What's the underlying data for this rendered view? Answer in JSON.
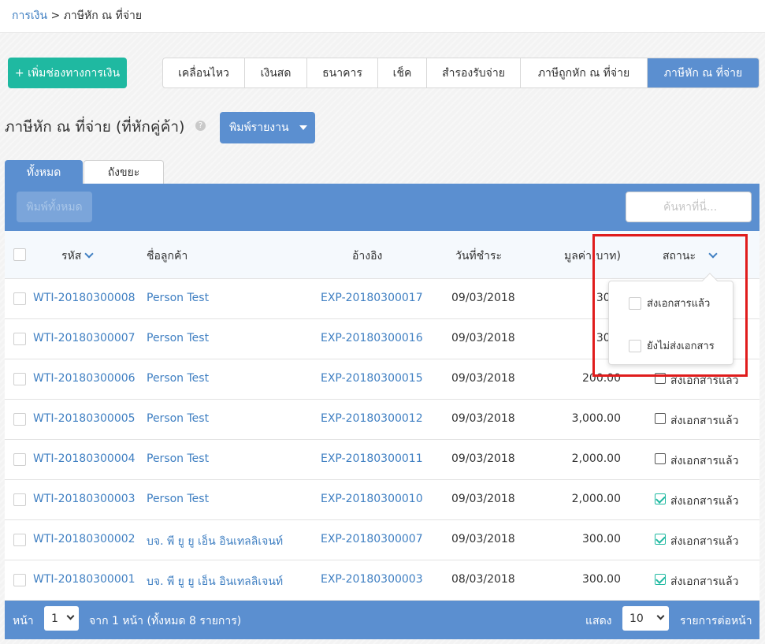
{
  "breadcrumb": {
    "parent": "การเงิน",
    "separator": ">",
    "current": "ภาษีหัก ณ ที่จ่าย"
  },
  "add_button": "+ เพิ่มช่องทางการเงิน",
  "tabs": [
    {
      "label": "เคลื่อนไหว"
    },
    {
      "label": "เงินสด"
    },
    {
      "label": "ธนาคาร"
    },
    {
      "label": "เช็ค"
    },
    {
      "label": "สำรองรับจ่าย"
    },
    {
      "label": "ภาษีถูกหัก ณ ที่จ่าย"
    },
    {
      "label": "ภาษีหัก ณ ที่จ่าย",
      "active": true
    }
  ],
  "page_title": "ภาษีหัก ณ ที่จ่าย (ที่หักคู่ค้า)",
  "help_icon": "?",
  "print_report": "พิมพ์รายงาน",
  "subtabs": {
    "all": "ทั้งหมด",
    "trash": "ถังขยะ"
  },
  "print_all": "พิมพ์ทั้งหมด",
  "search_placeholder": "ค้นหาที่นี่...",
  "columns": {
    "code": "รหัส",
    "customer": "ชื่อลูกค้า",
    "ref": "อ้างอิง",
    "date": "วันที่ชำระ",
    "amount": "มูลค่า(บาท)",
    "status": "สถานะ"
  },
  "rows": [
    {
      "code": "WTI-20180300008",
      "customer": "Person Test",
      "ref": "EXP-20180300017",
      "date": "09/03/2018",
      "amount": "300.",
      "status": "",
      "checked": false
    },
    {
      "code": "WTI-20180300007",
      "customer": "Person Test",
      "ref": "EXP-20180300016",
      "date": "09/03/2018",
      "amount": "300.",
      "status": "",
      "checked": false
    },
    {
      "code": "WTI-20180300006",
      "customer": "Person Test",
      "ref": "EXP-20180300015",
      "date": "09/03/2018",
      "amount": "200.00",
      "status": "ส่งเอกสารแล้ว",
      "checked": false
    },
    {
      "code": "WTI-20180300005",
      "customer": "Person Test",
      "ref": "EXP-20180300012",
      "date": "09/03/2018",
      "amount": "3,000.00",
      "status": "ส่งเอกสารแล้ว",
      "checked": false
    },
    {
      "code": "WTI-20180300004",
      "customer": "Person Test",
      "ref": "EXP-20180300011",
      "date": "09/03/2018",
      "amount": "2,000.00",
      "status": "ส่งเอกสารแล้ว",
      "checked": false
    },
    {
      "code": "WTI-20180300003",
      "customer": "Person Test",
      "ref": "EXP-20180300010",
      "date": "09/03/2018",
      "amount": "2,000.00",
      "status": "ส่งเอกสารแล้ว",
      "checked": true
    },
    {
      "code": "WTI-20180300002",
      "customer": "บจ. พี ยู ยู เอ็น อินเทลลิเจนท์",
      "ref": "EXP-20180300007",
      "date": "09/03/2018",
      "amount": "300.00",
      "status": "ส่งเอกสารแล้ว",
      "checked": true
    },
    {
      "code": "WTI-20180300001",
      "customer": "บจ. พี ยู ยู เอ็น อินเทลลิเจนท์",
      "ref": "EXP-20180300003",
      "date": "08/03/2018",
      "amount": "300.00",
      "status": "ส่งเอกสารแล้ว",
      "checked": true
    }
  ],
  "status_filter": {
    "sent": "ส่งเอกสารแล้ว",
    "not_sent": "ยังไม่ส่งเอกสาร"
  },
  "footer": {
    "page_label": "หน้า",
    "page_value": "1",
    "page_info": "จาก 1 หน้า (ทั้งหมด 8 รายการ)",
    "show_label": "แสดง",
    "per_page_value": "10",
    "per_page_label": "รายการต่อหน้า"
  },
  "colors": {
    "accent": "#5b8fd0",
    "teal": "#1fb9a1",
    "link": "#3f7fc2",
    "highlight": "#e01c1c"
  }
}
